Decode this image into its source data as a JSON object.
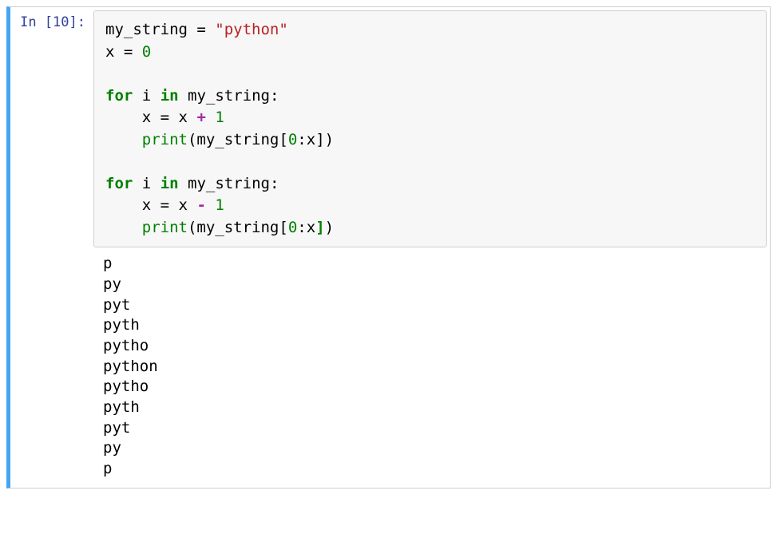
{
  "cell": {
    "prompt": "In [10]:",
    "code": {
      "l1_var": "my_string",
      "l1_eq": " = ",
      "l1_str": "\"python\"",
      "l2_var": "x",
      "l2_eq": " = ",
      "l2_num": "0",
      "l4_for": "for",
      "l4_sp1": " ",
      "l4_i": "i",
      "l4_sp2": " ",
      "l4_in": "in",
      "l4_sp3": " ",
      "l4_var": "my_string",
      "l4_colon": ":",
      "l5_indent": "    ",
      "l5_x1": "x",
      "l5_eq": " = ",
      "l5_x2": "x",
      "l5_sp": " ",
      "l5_op": "+",
      "l5_sp2": " ",
      "l5_num": "1",
      "l6_indent": "    ",
      "l6_fn": "print",
      "l6_lp": "(",
      "l6_var": "my_string",
      "l6_lb": "[",
      "l6_num": "0",
      "l6_colon": ":",
      "l6_x": "x",
      "l6_rb": "]",
      "l6_rp": ")",
      "l8_for": "for",
      "l8_sp1": " ",
      "l8_i": "i",
      "l8_sp2": " ",
      "l8_in": "in",
      "l8_sp3": " ",
      "l8_var": "my_string",
      "l8_colon": ":",
      "l9_indent": "    ",
      "l9_x1": "x",
      "l9_eq": " = ",
      "l9_x2": "x",
      "l9_sp": " ",
      "l9_op": "-",
      "l9_sp2": " ",
      "l9_num": "1",
      "l10_indent": "    ",
      "l10_fn": "print",
      "l10_lp": "(",
      "l10_var": "my_string",
      "l10_lb": "[",
      "l10_num": "0",
      "l10_colon": ":",
      "l10_x": "x",
      "l10_rb": "]",
      "l10_rp": ")"
    },
    "output_lines": [
      "p",
      "py",
      "pyt",
      "pyth",
      "pytho",
      "python",
      "pytho",
      "pyth",
      "pyt",
      "py",
      "p"
    ]
  }
}
